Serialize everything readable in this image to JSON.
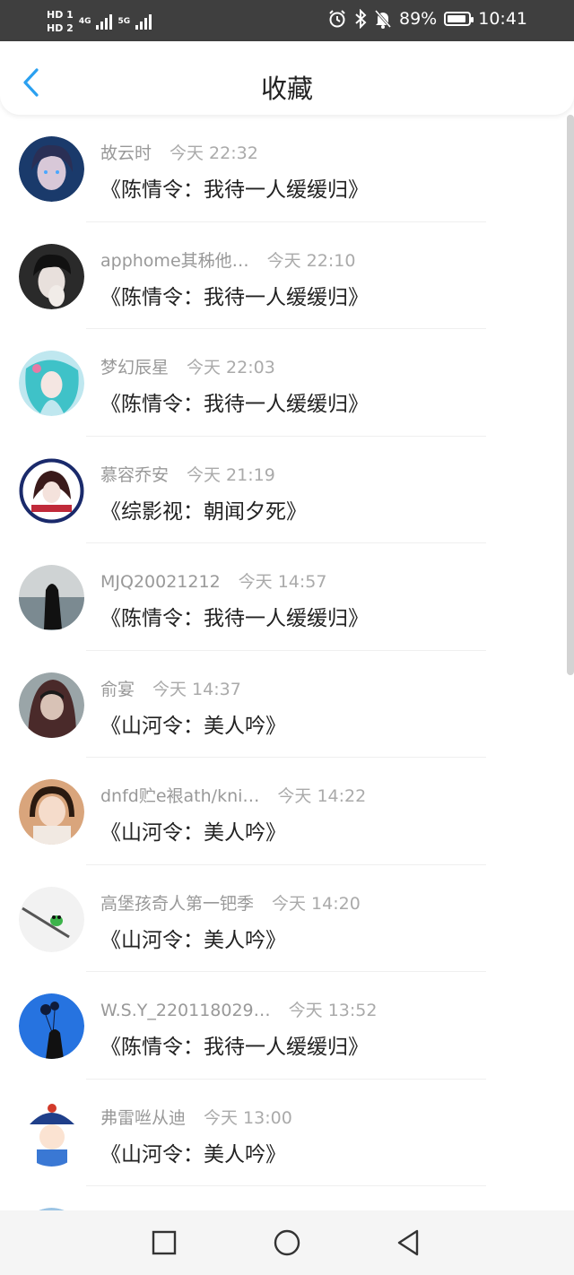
{
  "status_bar": {
    "hd1": "HD 1",
    "hd2": "HD 2",
    "net1": "4G",
    "net2": "5G",
    "battery_percent": "89%",
    "battery_level": 0.89,
    "time": "10:41",
    "icons": [
      "alarm-icon",
      "bluetooth-icon",
      "mute-icon"
    ]
  },
  "header": {
    "title": "收藏",
    "back_icon": "chevron-left-icon",
    "accent_color": "#2aa0f0"
  },
  "items": [
    {
      "name": "故云时",
      "time": "今天 22:32",
      "work": "《陈情令：我待一人缓缓归》",
      "avatar": "avatar-boy-blue"
    },
    {
      "name": "apphome其秭他…",
      "time": "今天 22:10",
      "work": "《陈情令：我待一人缓缓归》",
      "avatar": "avatar-boy-hand"
    },
    {
      "name": "梦幻辰星",
      "time": "今天 22:03",
      "work": "《陈情令：我待一人缓缓归》",
      "avatar": "avatar-cyan-girl"
    },
    {
      "name": "慕容乔安",
      "time": "今天 21:19",
      "work": "《综影视：朝闻夕死》",
      "avatar": "avatar-birthday-badge"
    },
    {
      "name": "MJQ20021212",
      "time": "今天 14:57",
      "work": "《陈情令：我待一人缓缓归》",
      "avatar": "avatar-hooded-figure"
    },
    {
      "name": "俞宴",
      "time": "今天 14:37",
      "work": "《山河令：美人吟》",
      "avatar": "avatar-hood-boy"
    },
    {
      "name": "dnfd贮e裉ath/kni…",
      "time": "今天 14:22",
      "work": "《山河令：美人吟》",
      "avatar": "avatar-little-girl"
    },
    {
      "name": "高堡孩奇人第一钯季",
      "time": "今天 14:20",
      "work": "《山河令：美人吟》",
      "avatar": "avatar-frog-doodle"
    },
    {
      "name": "W.S.Y_220118029…",
      "time": "今天 13:52",
      "work": "《陈情令：我待一人缓缓归》",
      "avatar": "avatar-balloons"
    },
    {
      "name": "弗雷咝从迪",
      "time": "今天 13:00",
      "work": "《山河令：美人吟》",
      "avatar": "avatar-qing-official"
    }
  ],
  "nav_bar": {
    "buttons": [
      "recents-square-icon",
      "home-circle-icon",
      "back-triangle-icon"
    ]
  }
}
